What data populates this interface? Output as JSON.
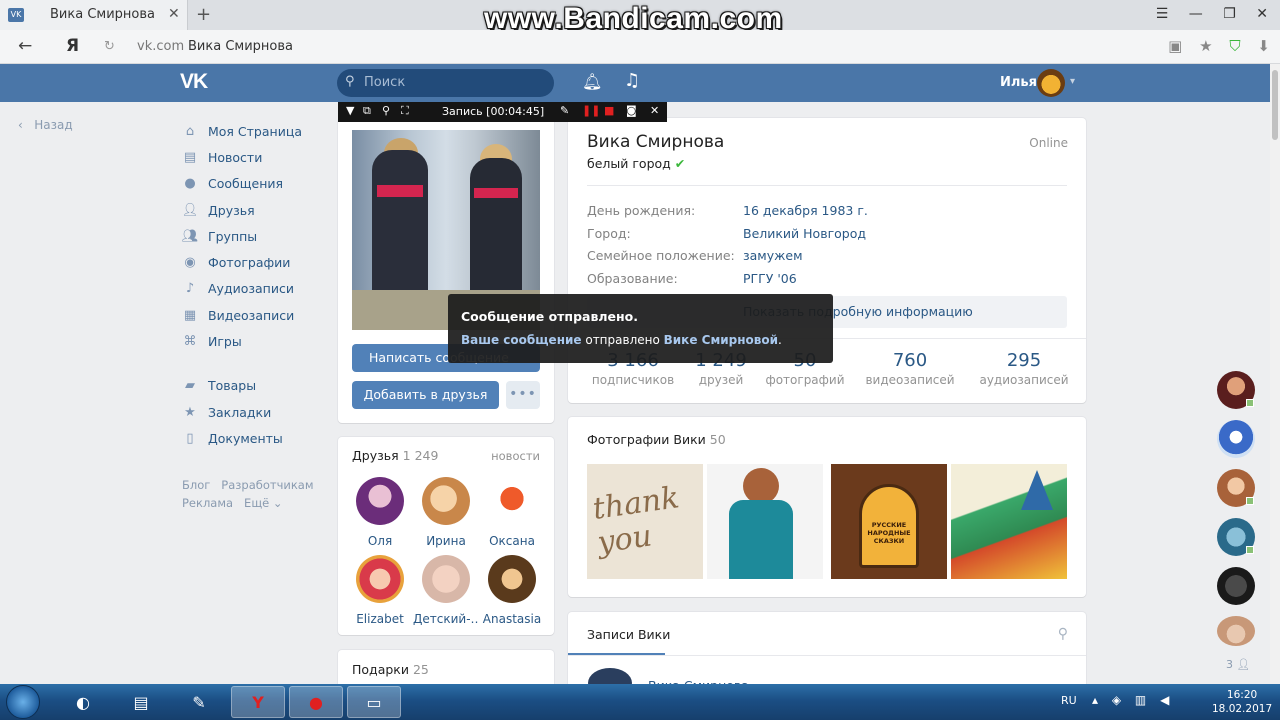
{
  "browser": {
    "tab_title": "Вика Смирнова",
    "tab_favicon": "VK",
    "new_tab": "+",
    "watermark": "www.Bandicam.com",
    "url_domain": "vk.com",
    "url_title": "Вика Смирнова",
    "yandex_label": "Я"
  },
  "vk_header": {
    "logo": "VK",
    "search_placeholder": "Поиск",
    "user_name": "Илья",
    "brand_color": "#4a76a8"
  },
  "left_nav": {
    "back": "Назад",
    "items": [
      {
        "label": "Моя Страница",
        "icon": "home-icon"
      },
      {
        "label": "Новости",
        "icon": "news-icon"
      },
      {
        "label": "Сообщения",
        "icon": "messages-icon"
      },
      {
        "label": "Друзья",
        "icon": "friends-icon"
      },
      {
        "label": "Группы",
        "icon": "groups-icon"
      },
      {
        "label": "Фотографии",
        "icon": "camera-icon"
      },
      {
        "label": "Аудиозаписи",
        "icon": "music-icon"
      },
      {
        "label": "Видеозаписи",
        "icon": "video-icon"
      },
      {
        "label": "Игры",
        "icon": "gamepad-icon"
      },
      {
        "label": "Товары",
        "icon": "bag-icon"
      },
      {
        "label": "Закладки",
        "icon": "star-icon"
      },
      {
        "label": "Документы",
        "icon": "document-icon"
      }
    ],
    "footer": {
      "blog": "Блог",
      "developers": "Разработчикам",
      "ads": "Реклама",
      "more": "Ещё"
    }
  },
  "profile": {
    "name": "Вика Смирнова",
    "status": "белый город",
    "online": "Online",
    "info": [
      {
        "label": "День рождения:",
        "value": "16 декабря 1983 г."
      },
      {
        "label": "Город:",
        "value": "Великий Новгород"
      },
      {
        "label": "Семейное положение:",
        "value": "замужем"
      },
      {
        "label": "Образование:",
        "value": "РГГУ '06"
      }
    ],
    "more_info": "Показать подробную информацию",
    "stats": [
      {
        "num": "3 166",
        "label": "подписчиков"
      },
      {
        "num": "1 249",
        "label": "друзей"
      },
      {
        "num": "50",
        "label": "фотографий"
      },
      {
        "num": "760",
        "label": "видеозаписей"
      },
      {
        "num": "295",
        "label": "аудиозаписей"
      }
    ],
    "write_message": "Написать сообщение",
    "add_friend": "Добавить в друзья",
    "more_dots": "•••"
  },
  "friends": {
    "title": "Друзья",
    "count": "1 249",
    "news_link": "новости",
    "list": [
      {
        "name": "Оля"
      },
      {
        "name": "Ирина"
      },
      {
        "name": "Оксана"
      },
      {
        "name": "Elizabet"
      },
      {
        "name": "Детский-…"
      },
      {
        "name": "Anastasia"
      }
    ]
  },
  "gifts": {
    "title": "Подарки",
    "count": "25"
  },
  "photos": {
    "title": "Фотографии Вики",
    "count": "50",
    "thumb1_text": "thank you",
    "thumb3_text": "РУССКИЕ НАРОДНЫЕ СКАЗКИ"
  },
  "posts": {
    "tab": "Записи Вики",
    "author": "Вика Смирнова"
  },
  "recorder": {
    "text": "Запись [00:04:45]"
  },
  "toast": {
    "title": "Сообщение отправлено.",
    "link1": "Ваше сообщение",
    "middle": " отправлено ",
    "link2": "Вике Смирновой",
    "end": "."
  },
  "chat": {
    "count": "3"
  },
  "taskbar": {
    "lang": "RU",
    "time": "16:20",
    "date": "18.02.2017"
  }
}
